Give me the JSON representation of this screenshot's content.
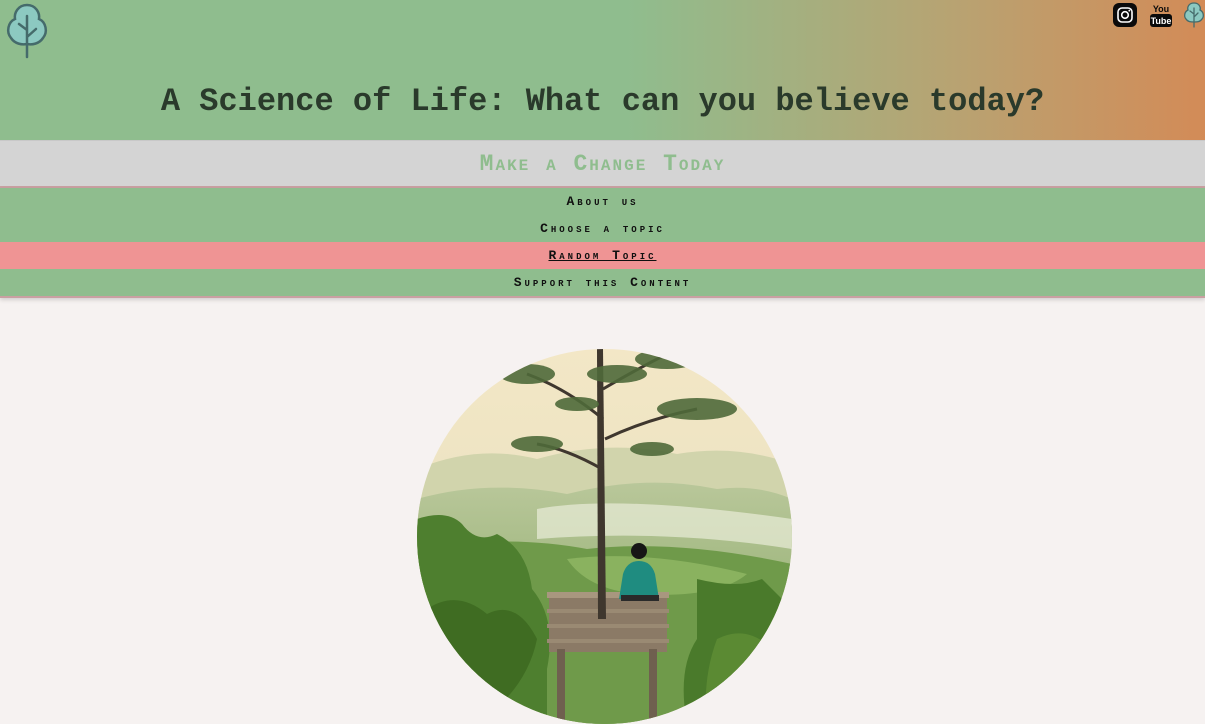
{
  "header": {
    "title": "A Science of Life:  What can you believe today?",
    "logo_icon": "tree-icon",
    "social": [
      {
        "name": "instagram-icon"
      },
      {
        "name": "youtube-icon",
        "label": "You Tube"
      },
      {
        "name": "tree-link-icon"
      }
    ]
  },
  "banner": {
    "text": "Make a Change Today"
  },
  "nav": {
    "items": [
      {
        "label": "About us",
        "active": false
      },
      {
        "label": "Choose a topic",
        "active": false
      },
      {
        "label": "Random Topic",
        "active": true
      },
      {
        "label": "Support this Content",
        "active": false
      }
    ]
  },
  "hero": {
    "icon": "meditating-person-landscape-image"
  },
  "colors": {
    "header_green": "#8fbd8e",
    "header_orange": "#d38b57",
    "banner_gray": "#d4d4d4",
    "active_pink": "#ef9494",
    "page_bg": "#f6f2f1",
    "title_text": "#2a3a2b"
  }
}
